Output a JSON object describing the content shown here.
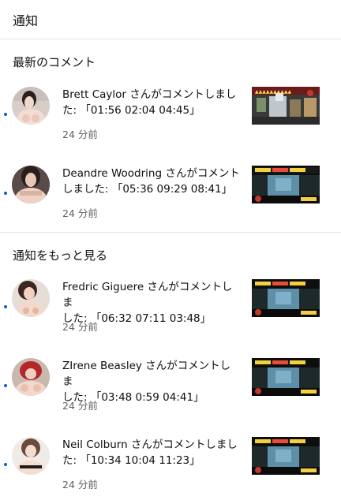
{
  "header": {
    "title": "通知"
  },
  "sections": [
    {
      "title": "最新のコメント",
      "items": [
        {
          "name": "Brett Caylor",
          "line1": "Brett Caylor さんがコメントしまし",
          "line2": "た: 「01:56 02:04 04:45」",
          "time": "24 分前"
        },
        {
          "name": "Deandre Woodring",
          "line1": "Deandre Woodring さんがコメント",
          "line2": "しました: 「05:36 09:29 08:41」",
          "time": "24 分前"
        }
      ]
    },
    {
      "title": "通知をもっと見る",
      "items": [
        {
          "name": "Fredric Giguere",
          "line1": "Fredric Giguere さんがコメントしま",
          "line2": "した: 「06:32 07:11 03:48」",
          "time": "24 分前"
        },
        {
          "name": "ZIrene Beasley",
          "line1": "ZIrene Beasley さんがコメントしま",
          "line2": "した: 「03:48 0:59 04:41」",
          "time": "24 分前"
        },
        {
          "name": "Neil Colburn",
          "line1": "Neil Colburn さんがコメントしまし",
          "line2": "た: 「10:34 10:04 11:23」",
          "time": "24 分前"
        }
      ]
    }
  ],
  "colors": {
    "unread_dot": "#065fd4",
    "secondary_text": "#606060",
    "divider": "#e5e5e5"
  }
}
